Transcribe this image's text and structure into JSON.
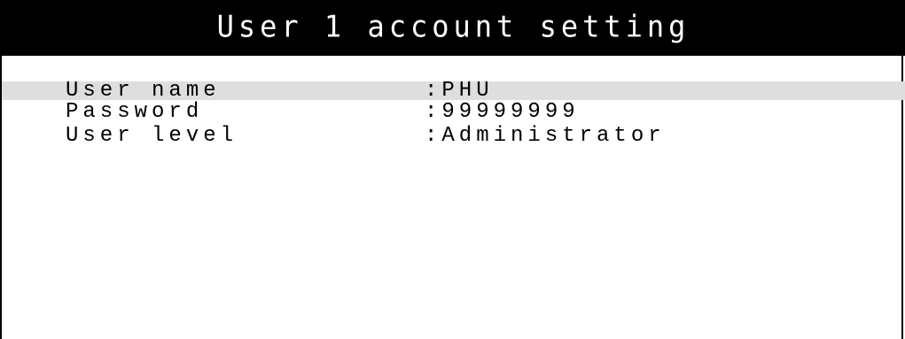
{
  "screen": {
    "title": "User 1 account setting"
  },
  "fields": [
    {
      "label": "User name",
      "value": ":PHU"
    },
    {
      "label": "Password",
      "value": ":99999999"
    },
    {
      "label": "User level",
      "value": ":Administrator"
    }
  ],
  "colors": {
    "title_bar_background": "#000000",
    "title_text": "#ffffff",
    "selected_row_background": "#dedede",
    "text": "#000000"
  }
}
